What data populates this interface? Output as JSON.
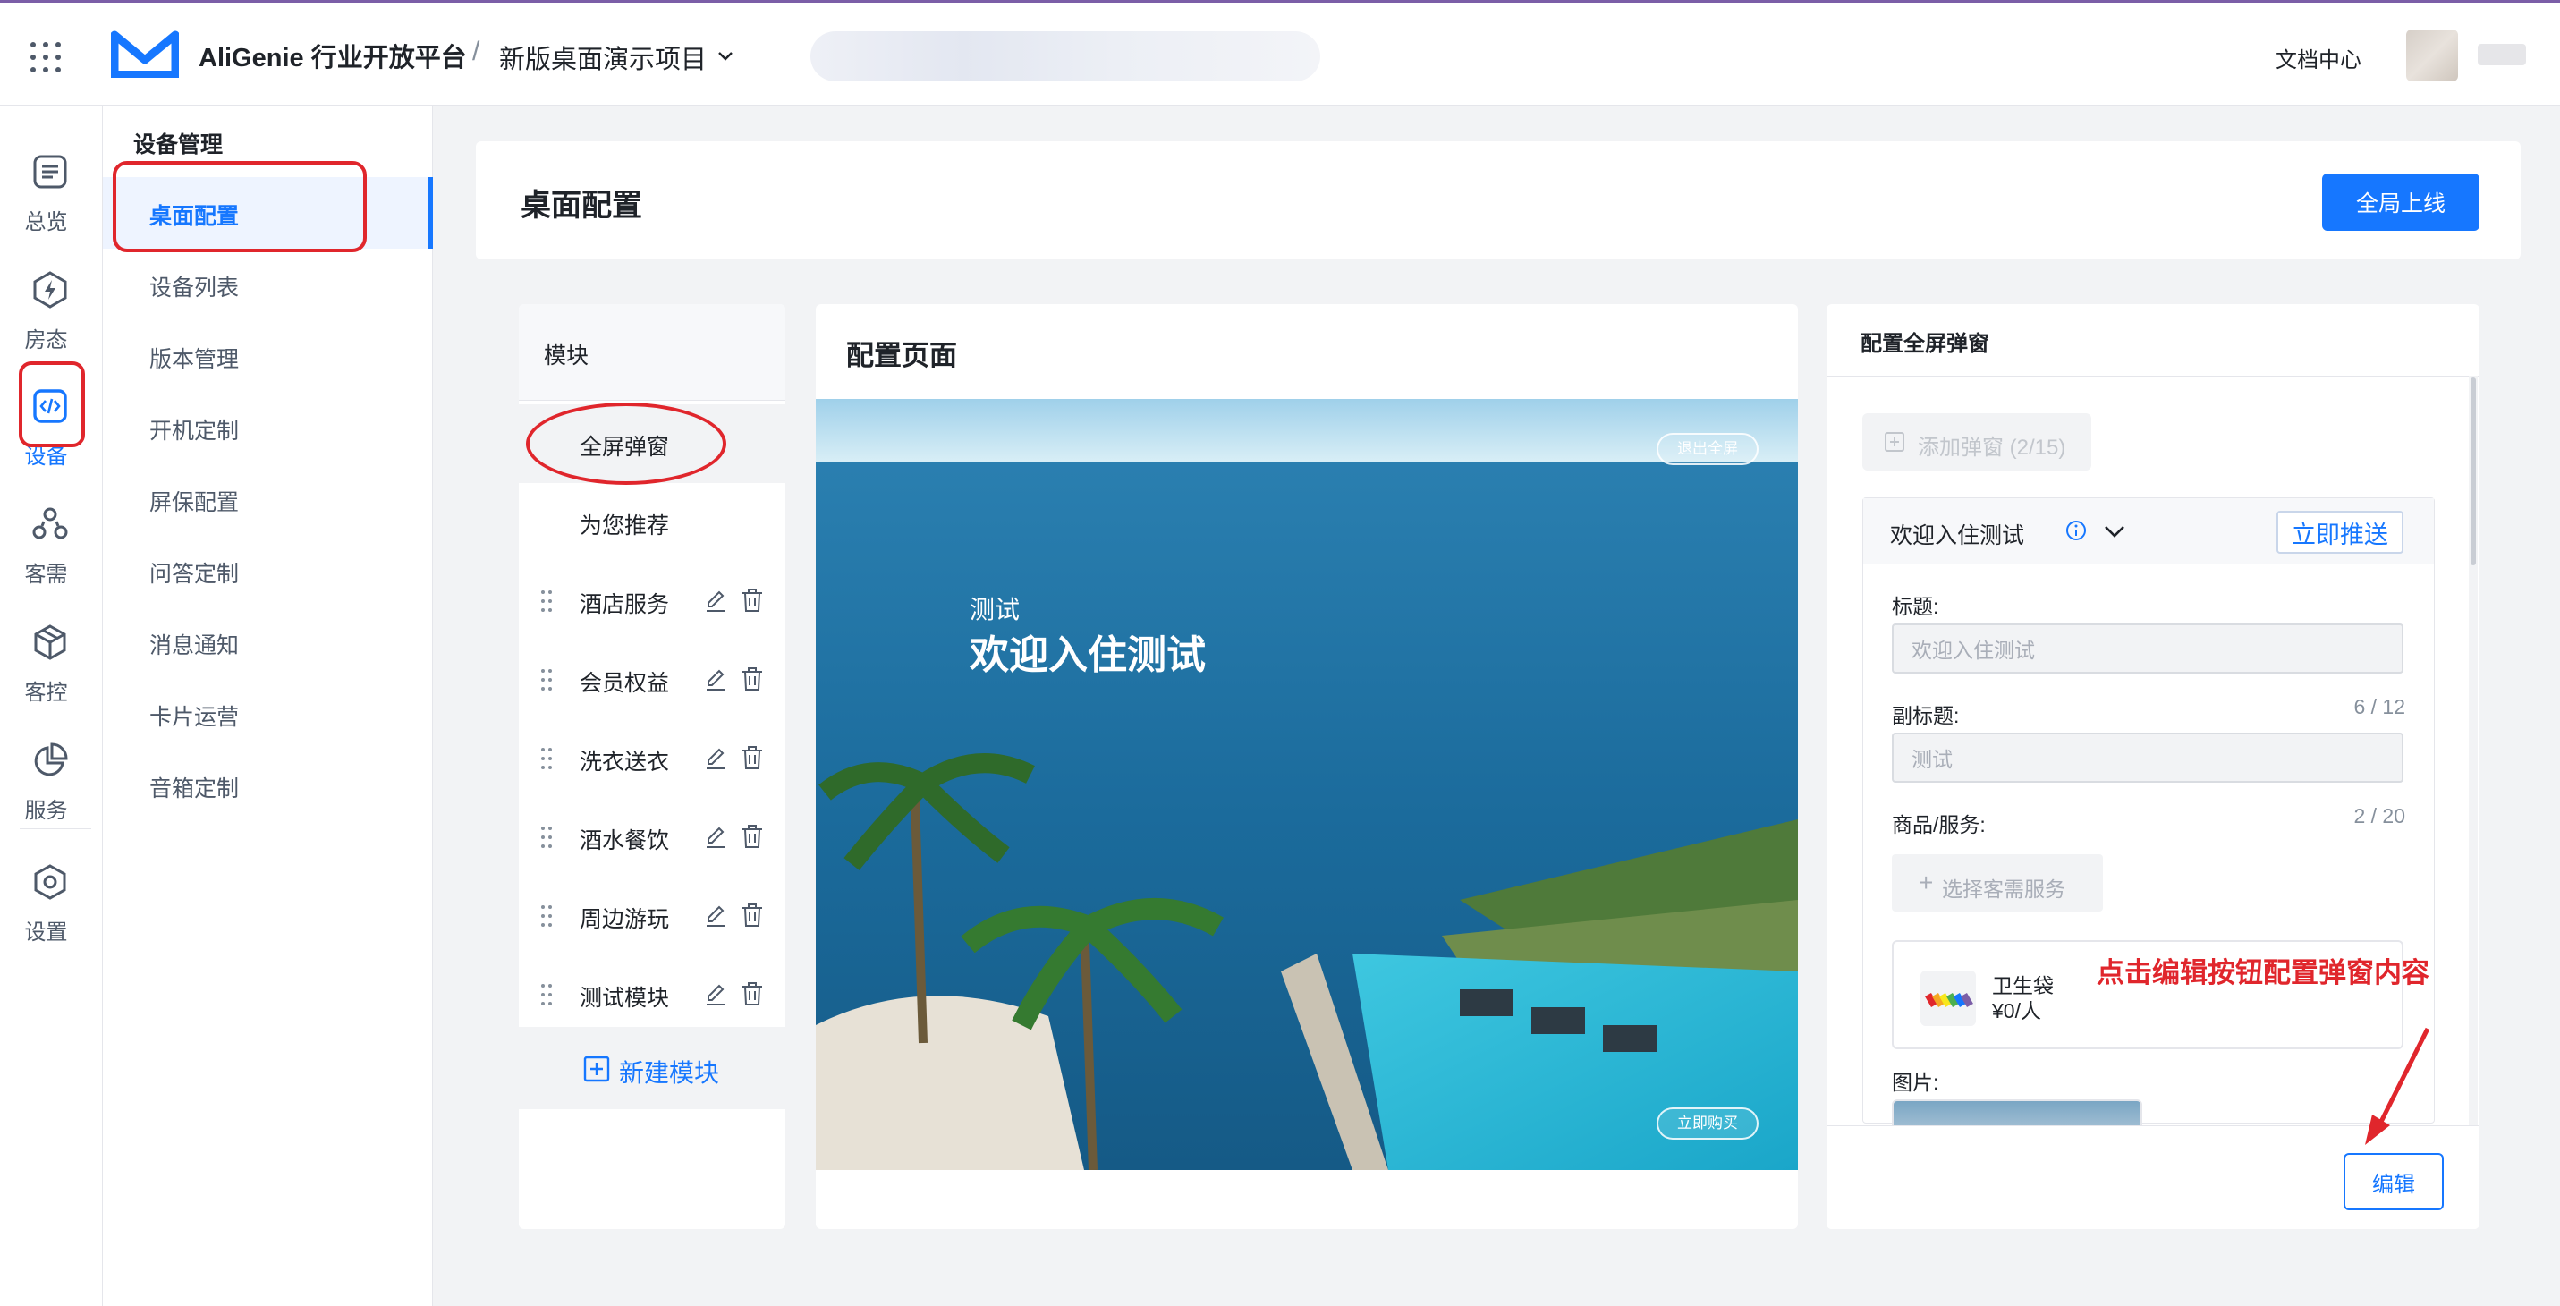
{
  "header": {
    "brand": "AliGenie 行业开放平台",
    "separator": "/",
    "project": "新版桌面演示项目",
    "docs": "文档中心"
  },
  "rail": {
    "items": [
      {
        "label": "总览",
        "icon": "list-icon"
      },
      {
        "label": "房态",
        "icon": "lightning-icon"
      },
      {
        "label": "设备",
        "icon": "code-icon"
      },
      {
        "label": "客需",
        "icon": "people-icon"
      },
      {
        "label": "客控",
        "icon": "cube-icon"
      },
      {
        "label": "服务",
        "icon": "pie-icon"
      },
      {
        "label": "设置",
        "icon": "hexagon-settings-icon"
      }
    ]
  },
  "submenu": {
    "title": "设备管理",
    "items": [
      "桌面配置",
      "设备列表",
      "版本管理",
      "开机定制",
      "屏保配置",
      "问答定制",
      "消息通知",
      "卡片运营",
      "音箱定制"
    ]
  },
  "page": {
    "title": "桌面配置",
    "publish_label": "全局上线"
  },
  "modules": {
    "title": "模块",
    "items": [
      "全屏弹窗",
      "为您推荐",
      "酒店服务",
      "会员权益",
      "洗衣送衣",
      "酒水餐饮",
      "周边游玩",
      "测试模块"
    ],
    "new_label": "新建模块"
  },
  "config": {
    "title": "配置页面",
    "exit_fullscreen": "退出全屏",
    "buy_now": "立即购买",
    "preview_subtitle": "测试",
    "preview_title": "欢迎入住测试"
  },
  "popup": {
    "title": "配置全屏弹窗",
    "add_label": "添加弹窗 (2/15)",
    "panel_name": "欢迎入住测试",
    "push_label": "立即推送",
    "title_label": "标题:",
    "title_value": "欢迎入住测试",
    "subtitle_label": "副标题:",
    "subtitle_count": "6 / 12",
    "subtitle_value": "测试",
    "service_label": "商品/服务:",
    "service_count": "2 / 20",
    "select_service": "选择客需服务",
    "product_name": "卫生袋",
    "product_price": "¥0/人",
    "image_label": "图片:",
    "edit_label": "编辑"
  },
  "annotation": "点击编辑按钮配置弹窗内容",
  "colors": {
    "primary": "#1677ff",
    "annotation_red": "#e0262c"
  }
}
